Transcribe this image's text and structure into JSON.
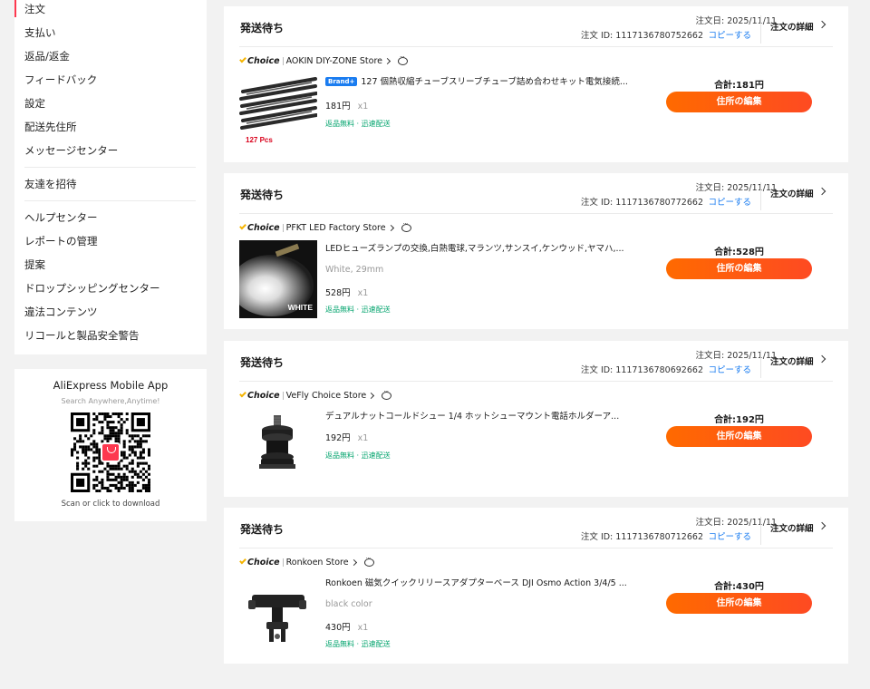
{
  "sidebar": {
    "group1": [
      "注文",
      "支払い",
      "返品/返金",
      "フィードバック",
      "設定",
      "配送先住所",
      "メッセージセンター"
    ],
    "group2": [
      "友達を招待"
    ],
    "group3": [
      "ヘルプセンター",
      "レポートの管理",
      "提案",
      "ドロップシッピングセンター",
      "違法コンテンツ",
      "リコールと製品安全警告"
    ]
  },
  "app_promo": {
    "title": "AliExpress Mobile App",
    "subtitle": "Search Anywhere,Anytime!",
    "footer": "Scan or click to download"
  },
  "labels": {
    "order_date_prefix": "注文日: ",
    "order_id_prefix": "注文 ID: ",
    "copy": "コピーする",
    "details": "注文の詳細",
    "choice": "Choice",
    "total_prefix": "合計:",
    "edit_address": "住所の編集",
    "qty": "x1"
  },
  "accent_colors": {
    "button": "#ff6a00",
    "link": "#1a7cf0",
    "shipping": "#00a36c",
    "active": "#fd384f"
  },
  "orders": [
    {
      "status": "発送待ち",
      "date": "注文日: 2025/11/11",
      "order_id": "注文 ID: 1117136780752662",
      "store": "AOKIN DIY-ZONE Store",
      "brand_badge": "Brand+",
      "title": "127 個熱収縮チューブスリーブチューブ詰め合わせキット電気接続...",
      "variant": "",
      "price": "181円",
      "shipping": "返品無料 · 迅速配送",
      "total": "合計:181円",
      "image_caption": "127 Pcs"
    },
    {
      "status": "発送待ち",
      "date": "注文日: 2025/11/11",
      "order_id": "注文 ID: 1117136780772662",
      "store": "PFKT LED Factory Store",
      "brand_badge": "",
      "title": "LEDヒューズランプの交換,白熱電球,マランツ,サンスイ,ケンウッド,ヤマハ,...",
      "variant": "White, 29mm",
      "price": "528円",
      "shipping": "返品無料 · 迅速配送",
      "total": "合計:528円",
      "image_caption": "WHITE"
    },
    {
      "status": "発送待ち",
      "date": "注文日: 2025/11/11",
      "order_id": "注文 ID: 1117136780692662",
      "store": "VeFly Choice Store",
      "brand_badge": "",
      "title": "デュアルナットコールドシュー 1/4 ホットシューマウント電話ホルダーア...",
      "variant": "",
      "price": "192円",
      "shipping": "返品無料 · 迅速配送",
      "total": "合計:192円",
      "image_caption": ""
    },
    {
      "status": "発送待ち",
      "date": "注文日: 2025/11/11",
      "order_id": "注文 ID: 1117136780712662",
      "store": "Ronkoen Store",
      "brand_badge": "",
      "title": "Ronkoen 磁気クイックリリースアダプターベース DJI Osmo Action 3/4/5 ...",
      "variant": "black color",
      "price": "430円",
      "shipping": "返品無料 · 迅速配送",
      "total": "合計:430円",
      "image_caption": ""
    }
  ]
}
